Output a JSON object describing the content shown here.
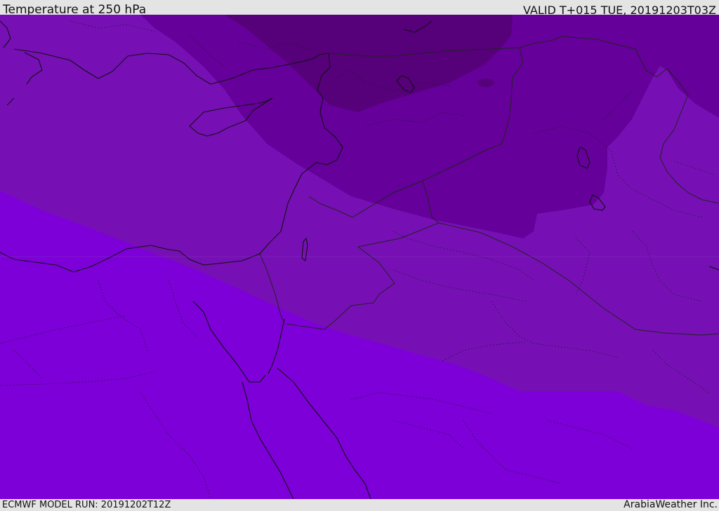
{
  "header": {
    "title": "Temperature at 250 hPa",
    "valid": "VALID T+015 TUE, 20191203T03Z"
  },
  "footer": {
    "model_run": "ECMWF MODEL RUN: 20191202T12Z",
    "credit": "ArabiaWeather Inc."
  },
  "colors": {
    "band_coldest": "#56007a",
    "band_cold": "#65009a",
    "band_mid": "#7610b4",
    "band_warm": "#7d00d8",
    "coastline": "#111111",
    "border": "#222222",
    "frame": "#e4e4e4"
  }
}
